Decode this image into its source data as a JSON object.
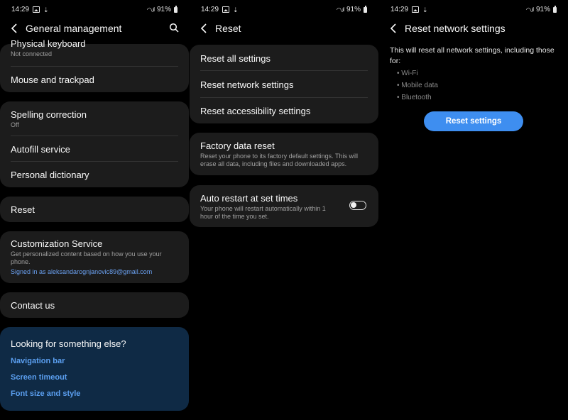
{
  "status": {
    "time": "14:29",
    "battery": "91%"
  },
  "panel1": {
    "title": "General management",
    "items": {
      "physical_keyboard": {
        "title": "Physical keyboard",
        "sub": "Not connected"
      },
      "mouse": {
        "title": "Mouse and trackpad"
      },
      "spelling": {
        "title": "Spelling correction",
        "sub": "Off"
      },
      "autofill": {
        "title": "Autofill service"
      },
      "dictionary": {
        "title": "Personal dictionary"
      },
      "reset": {
        "title": "Reset"
      },
      "customization": {
        "title": "Customization Service",
        "sub": "Get personalized content based on how you use your phone.",
        "link": "Signed in as aleksandarognjanovic89@gmail.com"
      },
      "contact": {
        "title": "Contact us"
      }
    },
    "looking": {
      "title": "Looking for something else?",
      "links": [
        "Navigation bar",
        "Screen timeout",
        "Font size and style"
      ]
    }
  },
  "panel2": {
    "title": "Reset",
    "items": {
      "reset_all": "Reset all settings",
      "reset_network": "Reset network settings",
      "reset_accessibility": "Reset accessibility settings",
      "factory": {
        "title": "Factory data reset",
        "sub": "Reset your phone to its factory default settings. This will erase all data, including files and downloaded apps."
      },
      "auto_restart": {
        "title": "Auto restart at set times",
        "sub": "Your phone will restart automatically within 1 hour of the time you set.",
        "enabled": false
      }
    }
  },
  "panel3": {
    "title": "Reset network settings",
    "description": "This will reset all network settings, including those for:",
    "bullets": [
      "Wi-Fi",
      "Mobile data",
      "Bluetooth"
    ],
    "button": "Reset settings"
  },
  "colors": {
    "accent": "#3e8ef0",
    "link": "#5b9ff0",
    "card": "#1c1c1c",
    "highlight_card": "#0f2a45"
  }
}
